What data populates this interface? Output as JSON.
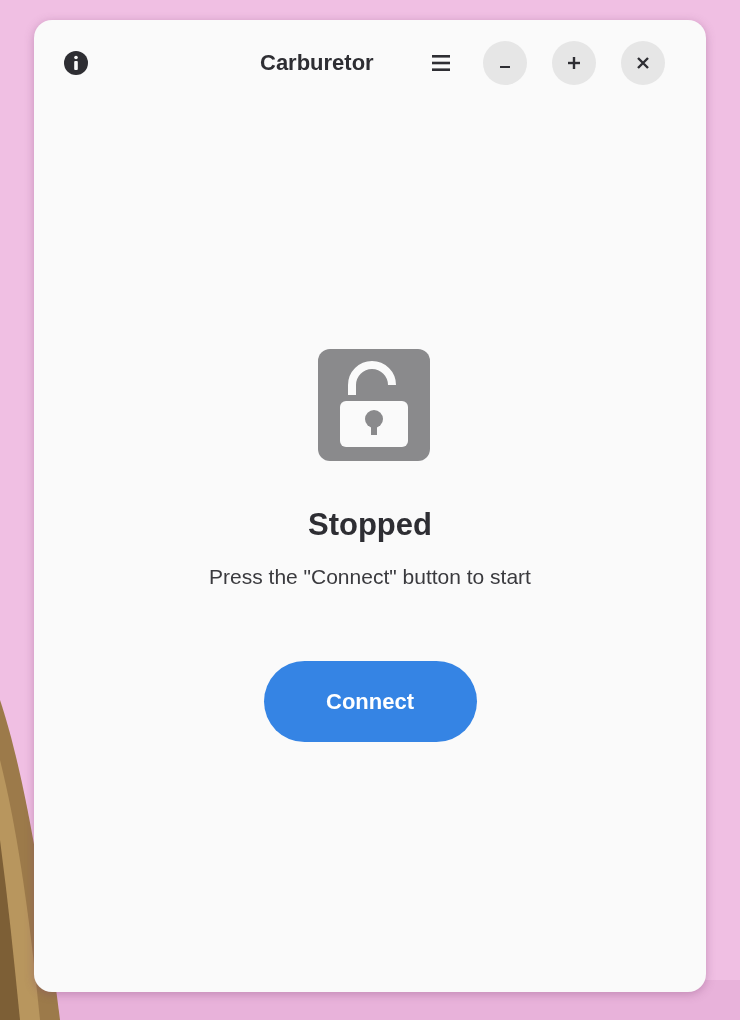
{
  "window": {
    "title": "Carburetor"
  },
  "status": {
    "kind": "stopped",
    "title": "Stopped",
    "message": "Press the \"Connect\" button to start"
  },
  "action_button": {
    "label": "Connect"
  }
}
